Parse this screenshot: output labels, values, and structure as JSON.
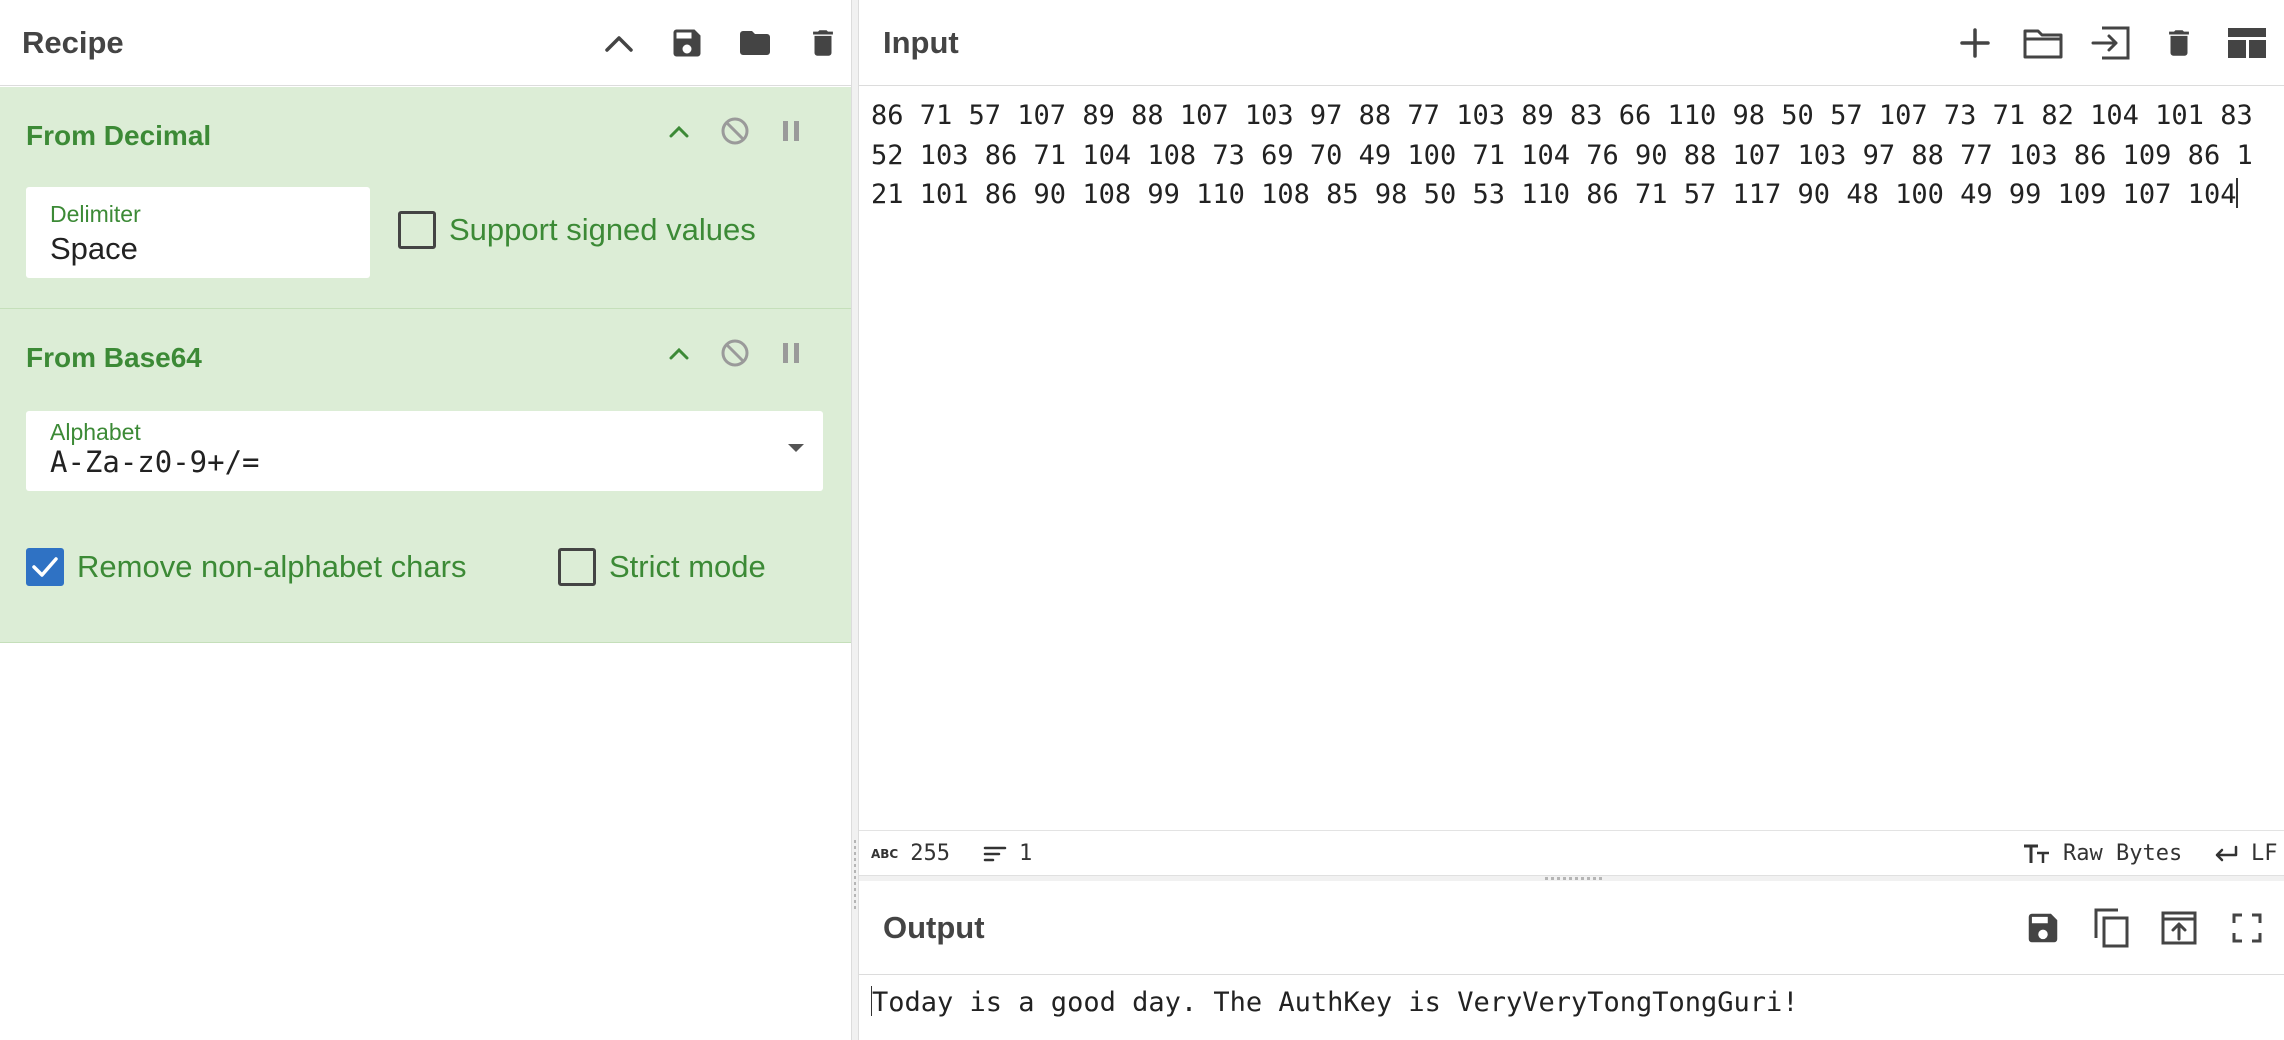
{
  "recipe": {
    "title": "Recipe",
    "header_icons": [
      "chevron-up-icon",
      "save-icon",
      "folder-icon",
      "trash-icon"
    ],
    "operations": [
      {
        "name": "From Decimal",
        "fields": [
          {
            "label": "Delimiter",
            "value": "Space"
          }
        ],
        "checkboxes": [
          {
            "label": "Support signed values",
            "checked": false
          }
        ]
      },
      {
        "name": "From Base64",
        "fields": [
          {
            "label": "Alphabet",
            "value": "A-Za-z0-9+/="
          }
        ],
        "checkboxes": [
          {
            "label": "Remove non-alphabet chars",
            "checked": true
          },
          {
            "label": "Strict mode",
            "checked": false
          }
        ]
      }
    ]
  },
  "input": {
    "title": "Input",
    "text": "86 71 57 107 89 88 107 103 97 88 77 103 89 83 66 110 98 50 57 107 73 71 82 104 101 83 52 103 86 71 104 108 73 69 70 49 100 71 104 76 90 88 107 103 97 88 77 103 86 109 86 121 101 86 90 108 99 110 108 85 98 50 53 110 86 71 57 117 90 48 100 49 99 109 107 104",
    "header_icons": [
      "plus-icon",
      "folder-icon",
      "input-icon",
      "trash-icon",
      "layout-icon"
    ],
    "status": {
      "length_label": "255",
      "lines_label": "1",
      "encoding": "Raw Bytes",
      "eol": "LF"
    }
  },
  "output": {
    "title": "Output",
    "text": "Today is a good day. The AuthKey is VeryVeryTongTongGuri!",
    "header_icons": [
      "save-icon",
      "copy-icon",
      "replace-input-icon",
      "fullscreen-icon"
    ]
  },
  "colors": {
    "operation_bg": "#dcedd6",
    "operation_text": "#3c8a36",
    "checkbox_checked": "#2f72c4",
    "icon": "#444444"
  }
}
